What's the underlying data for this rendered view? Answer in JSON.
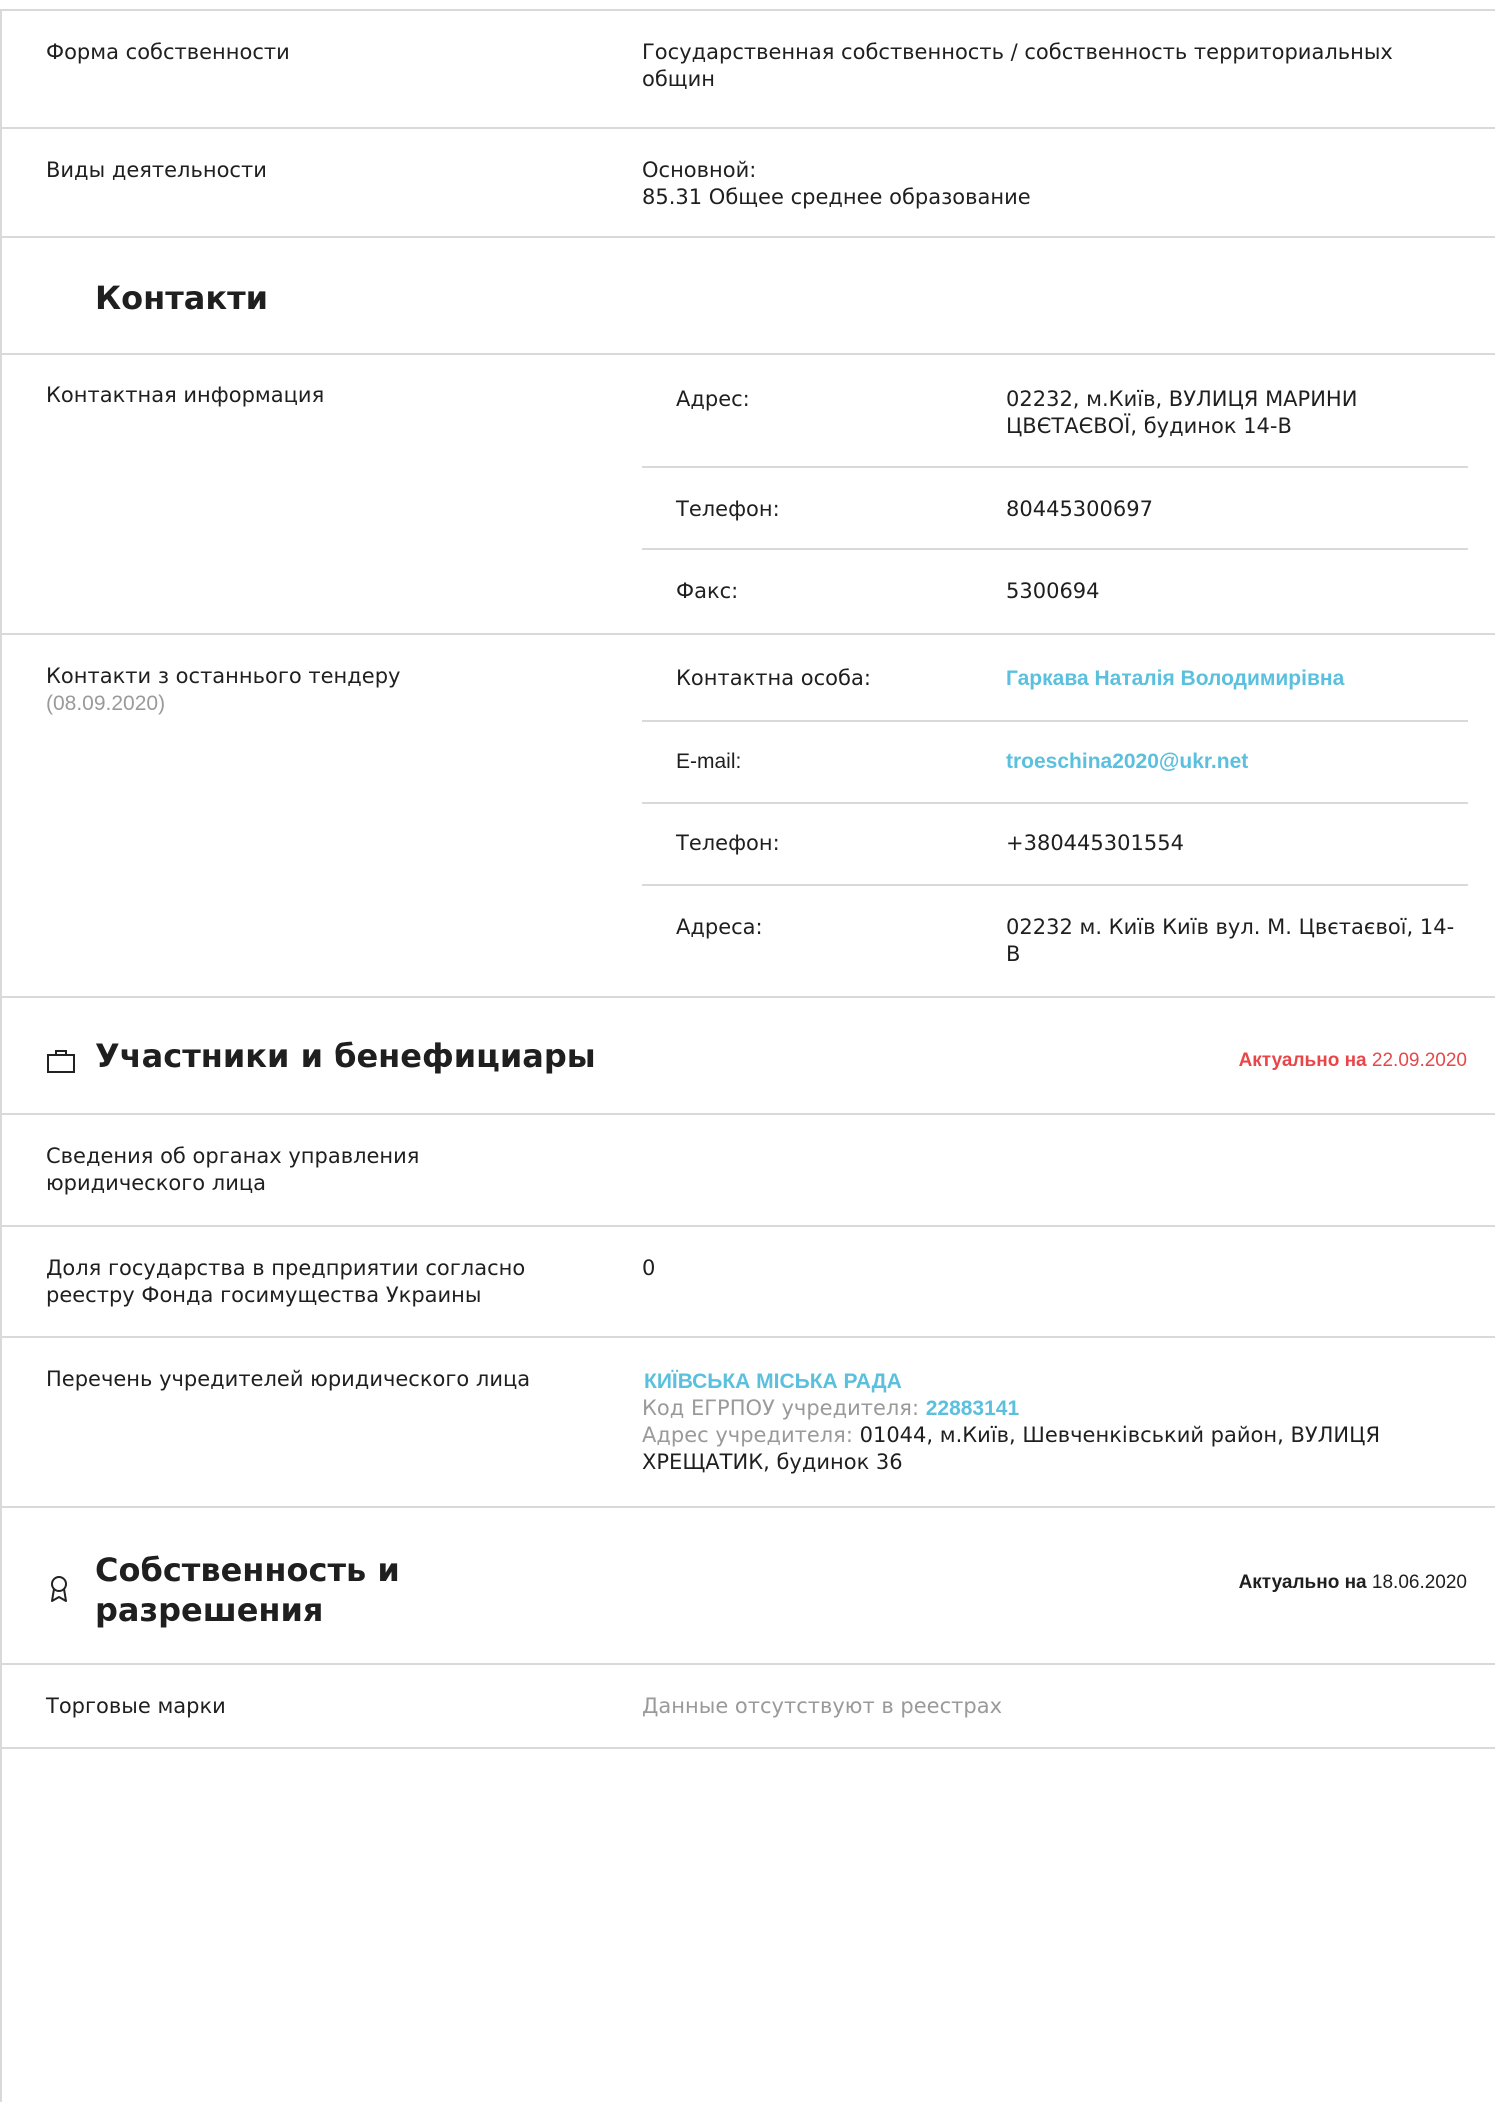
{
  "general": {
    "ownership_label": "Форма собственности",
    "ownership_value": "Государственная собственность / собственность территориальных общин",
    "activities_label": "Виды деятельности",
    "activities_main": "Основной:",
    "activities_value": "85.31 Общее среднее образование"
  },
  "contacts": {
    "title": "Контакти",
    "contact_info_label": "Контактная информация",
    "address_label": "Адрес:",
    "address_value": "02232, м.Київ, ВУЛИЦЯ МАРИНИ ЦВЄТАЄВОЇ, будинок 14-В",
    "phone_label": "Телефон:",
    "phone_value": "80445300697",
    "fax_label": "Факс:",
    "fax_value": "5300694",
    "tender_label": "Контакти з останнього тендеру",
    "tender_date": "(08.09.2020)",
    "person_label": "Контактна особа:",
    "person_value": "Гаркава Наталія Володимирівна",
    "email_label": "E-mail:",
    "email_value": "troeschina2020@ukr.net",
    "tender_phone_label": "Телефон:",
    "tender_phone_value": "+380445301554",
    "tender_address_label": "Адреса:",
    "tender_address_value": "02232 м. Київ Київ вул. М. Цвєтаєвої, 14-В"
  },
  "participants": {
    "title": "Участники и бенефициары",
    "actual_label": "Актуально на",
    "actual_date": "22.09.2020",
    "actual_color": "#e8474a",
    "governance_label": "Сведения об органах управления юридического лица",
    "state_share_label": "Доля государства в предприятии согласно реестру Фонда госимущества Украины",
    "state_share_value": "0",
    "founders_label": "Перечень учредителей юридического лица",
    "founder_name": "КИЇВСЬКА МІСЬКА РАДА",
    "founder_code_label": "Код ЕГРПОУ учредителя:",
    "founder_code": "22883141",
    "founder_address_label": "Адрес учредителя:",
    "founder_address": "01044, м.Київ, Шевченківський район, ВУЛИЦЯ ХРЕЩАТИК, будинок 36",
    "icon": "briefcase-icon"
  },
  "property": {
    "title": "Собственность и разрешения",
    "actual_label": "Актуально на",
    "actual_date": "18.06.2020",
    "trademarks_label": "Торговые марки",
    "trademarks_value": "Данные отсутствуют в реестрах",
    "icon": "award-icon"
  }
}
